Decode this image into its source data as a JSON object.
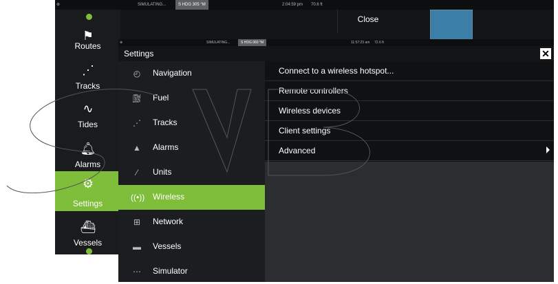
{
  "back_screen": {
    "status": {
      "mode": "SIMULATING...",
      "heading": "S HDG 305 °M",
      "time": "2:04:59 pm",
      "depth": "70.6 ft"
    },
    "close_label": "Close"
  },
  "left_menu": {
    "items": [
      {
        "label": "Routes",
        "icon": "routes-icon"
      },
      {
        "label": "Tracks",
        "icon": "tracks-icon"
      },
      {
        "label": "Tides",
        "icon": "tides-icon"
      },
      {
        "label": "Alarms",
        "icon": "alarm-bell-icon"
      },
      {
        "label": "Settings",
        "icon": "gear-icon",
        "active": true
      },
      {
        "label": "Vessels",
        "icon": "vessels-icon"
      }
    ]
  },
  "dialog": {
    "status": {
      "mode": "SIMULATING...",
      "heading": "S HDG 060 °M",
      "time": "11:57:23 am",
      "depth": "72.6 ft"
    },
    "title": "Settings",
    "categories": [
      {
        "label": "Navigation",
        "icon": "compass-icon"
      },
      {
        "label": "Fuel",
        "icon": "fuel-icon"
      },
      {
        "label": "Tracks",
        "icon": "tracks-icon"
      },
      {
        "label": "Alarms",
        "icon": "alarm-bell-icon"
      },
      {
        "label": "Units",
        "icon": "ruler-icon"
      },
      {
        "label": "Wireless",
        "icon": "wireless-icon",
        "active": true
      },
      {
        "label": "Network",
        "icon": "network-icon"
      },
      {
        "label": "Vessels",
        "icon": "vessels-icon"
      },
      {
        "label": "Simulator",
        "icon": "simulator-icon"
      }
    ],
    "options": [
      {
        "label": "Connect to a wireless hotspot..."
      },
      {
        "label": "Remote controllers"
      },
      {
        "label": "Wireless devices"
      },
      {
        "label": "Client settings"
      },
      {
        "label": "Advanced",
        "submenu": true
      }
    ]
  },
  "colors": {
    "accent": "#7fbe3a",
    "panel": "#1c1d20",
    "background": "#2b2d30"
  }
}
